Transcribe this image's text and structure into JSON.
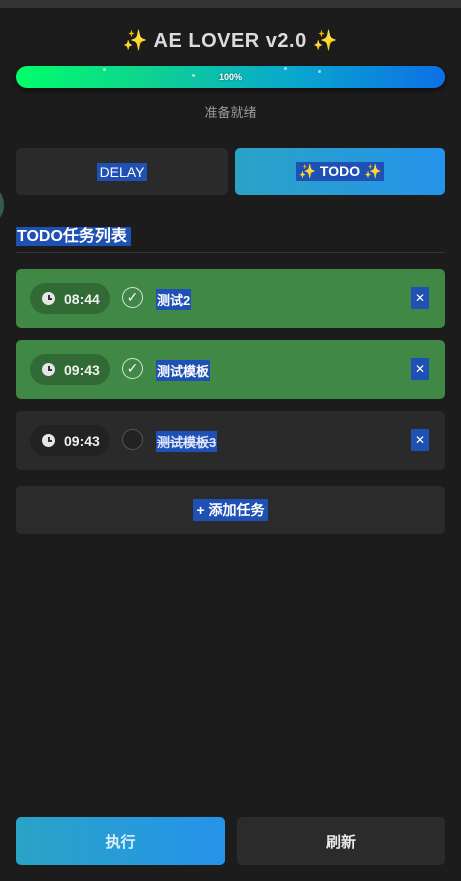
{
  "header": {
    "title": "✨ AE LOVER v2.0 ✨"
  },
  "progress": {
    "percent": 100,
    "label": "100%",
    "status": "准备就绪"
  },
  "tabs": [
    {
      "label": "DELAY",
      "active": false
    },
    {
      "label": "✨ TODO ✨",
      "active": true
    }
  ],
  "section": {
    "title": "TODO任务列表"
  },
  "tasks": [
    {
      "time": "08:44",
      "label": "测试2",
      "done": true,
      "check": "✓",
      "delete": "✕"
    },
    {
      "time": "09:43",
      "label": "测试模板",
      "done": true,
      "check": "✓",
      "delete": "✕"
    },
    {
      "time": "09:43",
      "label": "测试模板3",
      "done": false,
      "check": "",
      "delete": "✕"
    }
  ],
  "add_task": {
    "label": "+ 添加任务"
  },
  "footer": {
    "execute_label": "执行",
    "refresh_label": "刷新"
  },
  "colors": {
    "done_bg": "#3f8845",
    "accent": "#2593ea",
    "highlight": "#1f50b4"
  }
}
